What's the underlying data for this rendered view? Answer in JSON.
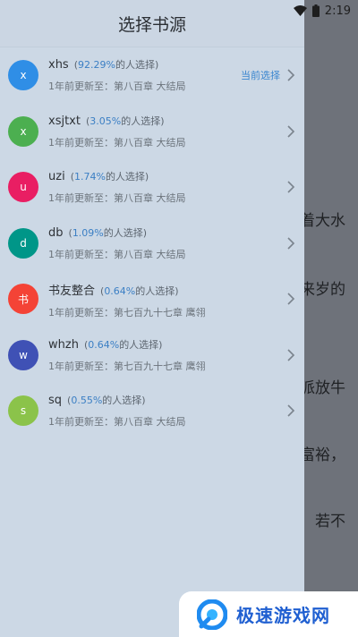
{
  "status_bar": {
    "time": "2:19"
  },
  "reader": {
    "lines": [
      "着大水",
      "来岁的",
      "派放牛",
      "富裕，",
      "若不"
    ]
  },
  "drawer": {
    "title": "选择书源",
    "current_label": "当前选择",
    "update_prefix": "1年前更新至：",
    "sources": [
      {
        "avatar_letter": "x",
        "avatar_color": "#2f8ee6",
        "name": "xhs",
        "percent": "92.29%",
        "percent_suffix": "的人选择)",
        "latest": "第八百章 大结局",
        "current": true
      },
      {
        "avatar_letter": "x",
        "avatar_color": "#4caf50",
        "name": "xsjtxt",
        "percent": "3.05%",
        "percent_suffix": "的人选择)",
        "latest": "第八百章 大结局",
        "current": false
      },
      {
        "avatar_letter": "u",
        "avatar_color": "#e91e63",
        "name": "uzi",
        "percent": "1.74%",
        "percent_suffix": "的人选择)",
        "latest": "第八百章 大结局",
        "current": false
      },
      {
        "avatar_letter": "d",
        "avatar_color": "#009688",
        "name": "db",
        "percent": "1.09%",
        "percent_suffix": "的人选择)",
        "latest": "第八百章 大结局",
        "current": false
      },
      {
        "avatar_letter": "书",
        "avatar_color": "#f44336",
        "name": "书友整合",
        "percent": "0.64%",
        "percent_suffix": "的人选择)",
        "latest": "第七百九十七章 鹰翎",
        "current": false
      },
      {
        "avatar_letter": "w",
        "avatar_color": "#3f51b5",
        "name": "whzh",
        "percent": "0.64%",
        "percent_suffix": "的人选择)",
        "latest": "第七百九十七章 鹰翎",
        "current": false
      },
      {
        "avatar_letter": "s",
        "avatar_color": "#8bc34a",
        "name": "sq",
        "percent": "0.55%",
        "percent_suffix": "的人选择)",
        "latest": "第八百章 大结局",
        "current": false
      }
    ]
  },
  "watermark": {
    "text": "极速游戏网"
  }
}
